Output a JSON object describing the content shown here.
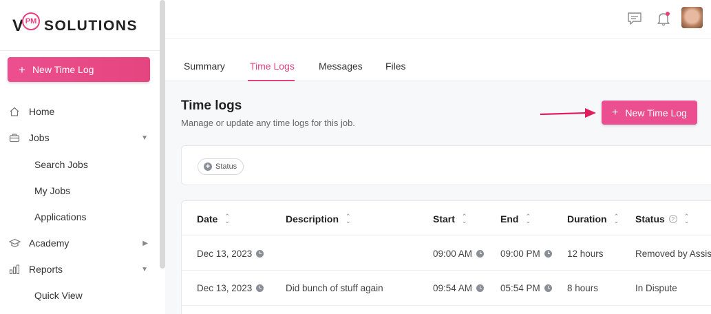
{
  "brand": {
    "letter": "V",
    "badge": "PM",
    "name": "SOLUTIONS",
    "accent": "#e8407d"
  },
  "sidebar": {
    "new_button": {
      "icon": "plus-icon",
      "label": "New Time Log"
    },
    "items": [
      {
        "label": "Home",
        "icon": "home-icon"
      },
      {
        "label": "Jobs",
        "icon": "briefcase-icon",
        "arrow": "▼"
      },
      {
        "label": "Search Jobs"
      },
      {
        "label": "My Jobs"
      },
      {
        "label": "Applications"
      },
      {
        "label": "Academy",
        "icon": "graduation-cap-icon",
        "arrow": "▶"
      },
      {
        "label": "Reports",
        "icon": "bar-chart-icon",
        "arrow": "▼"
      },
      {
        "label": "Quick View"
      }
    ]
  },
  "topbar": {
    "icons": [
      "chat-icon",
      "bell-icon"
    ],
    "avatar": "user-avatar"
  },
  "tabs": [
    {
      "label": "Summary",
      "active": false
    },
    {
      "label": "Time Logs",
      "active": true
    },
    {
      "label": "Messages",
      "active": false
    },
    {
      "label": "Files",
      "active": false
    }
  ],
  "section": {
    "title": "Time logs",
    "subtitle": "Manage or update any time logs for this job.",
    "primary_button": "New Time Log"
  },
  "filters": {
    "chip_label": "Status"
  },
  "table": {
    "columns": [
      "Date",
      "Description",
      "Start",
      "End",
      "Duration",
      "Status"
    ],
    "rows": [
      {
        "date": "Dec 13, 2023",
        "description": "",
        "start": "09:00 AM",
        "end": "09:00 PM",
        "duration": "12 hours",
        "status": "Removed by Assist"
      },
      {
        "date": "Dec 13, 2023",
        "description": "Did bunch of stuff again",
        "start": "09:54 AM",
        "end": "05:54 PM",
        "duration": "8 hours",
        "status": "In Dispute"
      }
    ]
  }
}
